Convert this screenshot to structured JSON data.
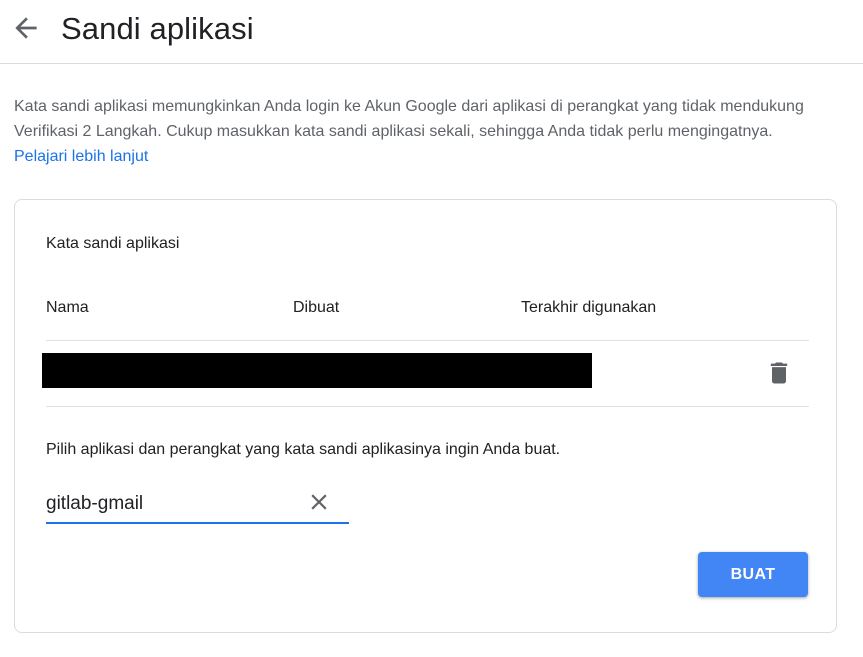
{
  "header": {
    "back_icon": "arrow-back-icon",
    "title": "Sandi aplikasi"
  },
  "intro": {
    "text": "Kata sandi aplikasi memungkinkan Anda login ke Akun Google dari aplikasi di perangkat yang tidak mendukung Verifikasi 2 Langkah. Cukup masukkan kata sandi aplikasi sekali, sehingga Anda tidak perlu mengingatnya.",
    "link_text": "Pelajari lebih lanjut"
  },
  "card": {
    "title": "Kata sandi aplikasi",
    "columns": {
      "name": "Nama",
      "created": "Dibuat",
      "last_used": "Terakhir digunakan"
    },
    "rows": [
      {
        "redacted": true,
        "delete_icon": "trash-icon"
      }
    ],
    "prompt": "Pilih aplikasi dan perangkat yang kata sandi aplikasinya ingin Anda buat.",
    "app_input": {
      "value": "gitlab-gmail",
      "clear_icon": "close-icon"
    },
    "create_button": "BUAT"
  },
  "colors": {
    "accent": "#1a73e8",
    "button": "#4285f4",
    "text_primary": "#202124",
    "text_secondary": "#5f6368",
    "divider": "#dadce0"
  }
}
